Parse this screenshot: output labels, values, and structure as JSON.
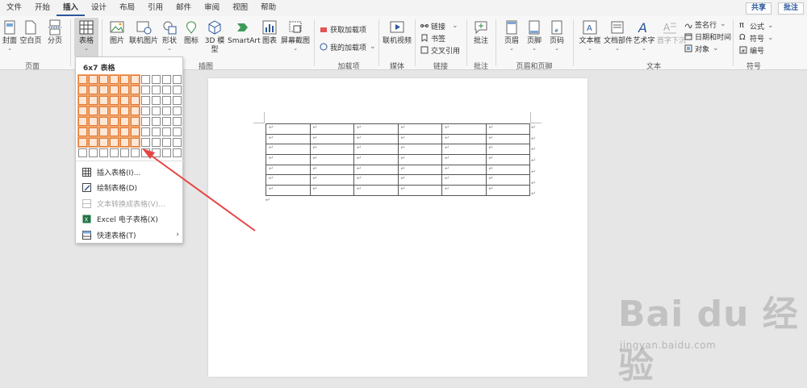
{
  "menu": {
    "items": [
      "文件",
      "开始",
      "插入",
      "设计",
      "布局",
      "引用",
      "邮件",
      "审阅",
      "视图",
      "帮助"
    ],
    "active": "插入",
    "share": "共享",
    "comments": "批注"
  },
  "ribbon": {
    "pages_group": {
      "label": "页面",
      "cover": "封面",
      "blank": "空白页",
      "break": "分页"
    },
    "table": {
      "label": "表格"
    },
    "illustrations": {
      "label": "插图",
      "picture": "图片",
      "online_picture": "联机图片",
      "shapes": "形状",
      "icons": "图标",
      "model_3d": "3D 模型",
      "smartart": "SmartArt",
      "chart": "图表",
      "screenshot": "屏幕截图"
    },
    "addins": {
      "label": "加载项",
      "get": "获取加载项",
      "mine": "我的加载项"
    },
    "media": {
      "label": "媒体",
      "video": "联机视频"
    },
    "links": {
      "label": "链接",
      "link": "链接",
      "bookmark": "书签",
      "crossref": "交叉引用"
    },
    "comments": {
      "label": "批注",
      "comment": "批注"
    },
    "header_footer": {
      "label": "页眉和页脚",
      "header": "页眉",
      "footer": "页脚",
      "page_number": "页码"
    },
    "text": {
      "label": "文本",
      "textbox": "文本框",
      "doc_parts": "文档部件",
      "wordart": "艺术字",
      "dropcap": "首字下沉",
      "signature": "签名行",
      "datetime": "日期和时间",
      "object": "对象"
    },
    "symbols": {
      "label": "符号",
      "equation": "公式",
      "symbol": "符号",
      "number": "编号"
    }
  },
  "table_dropdown": {
    "title": "6x7 表格",
    "grid_cols": 10,
    "grid_rows": 8,
    "selected_cols": 6,
    "selected_rows": 7,
    "items": [
      {
        "label": "插入表格(I)...",
        "icon": "insert-table-icon",
        "enabled": true
      },
      {
        "label": "绘制表格(D)",
        "icon": "draw-table-icon",
        "enabled": true
      },
      {
        "label": "文本转换成表格(V)...",
        "icon": "convert-text-icon",
        "enabled": false
      },
      {
        "label": "Excel 电子表格(X)",
        "icon": "excel-icon",
        "enabled": true
      },
      {
        "label": "快速表格(T)",
        "icon": "quick-table-icon",
        "enabled": true,
        "submenu": true
      }
    ]
  },
  "document": {
    "table_cols": 6,
    "table_rows": 7,
    "cell_mark": "↵"
  },
  "watermark": {
    "logo": "Bai du 经验",
    "url": "jingyan.baidu.com"
  },
  "colors": {
    "accent": "#2b579a",
    "highlight": "#e07b39",
    "arrow": "#e64545"
  }
}
